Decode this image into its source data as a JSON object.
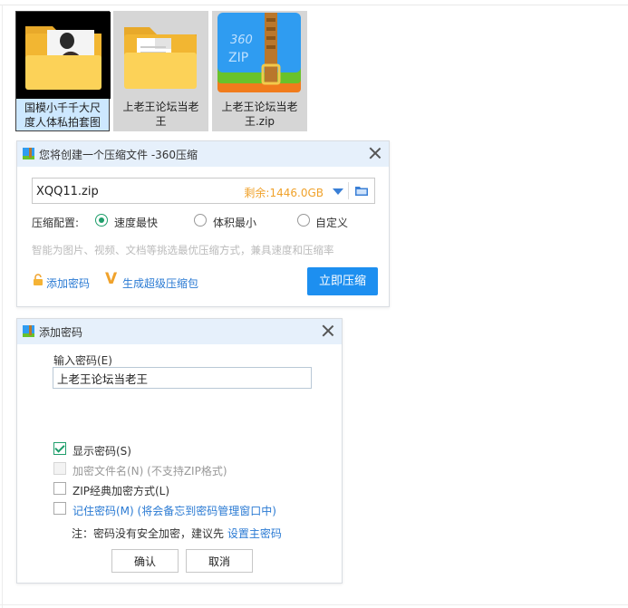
{
  "files": [
    {
      "name_line1": "国模小千千大尺",
      "name_line2": "度人体私拍套图"
    },
    {
      "name_line1": "上老王论坛当老",
      "name_line2": "王"
    },
    {
      "name_line1": "上老王论坛当老",
      "name_line2": "王.zip",
      "badge": "360",
      "badge2": "ZIP"
    }
  ],
  "compress_dialog": {
    "title": "您将创建一个压缩文件 -360压缩",
    "filename": "XQQ11.zip",
    "free_space": "剩余:1446.0GB",
    "config_label": "压缩配置:",
    "options": [
      {
        "label": "速度最快",
        "selected": true
      },
      {
        "label": "体积最小",
        "selected": false
      },
      {
        "label": "自定义",
        "selected": false
      }
    ],
    "description": "智能为图片、视频、文档等挑选最优压缩方式，兼具速度和压缩率",
    "add_password": "添加密码",
    "super_mark": "V",
    "super_package": "生成超级压缩包",
    "compress_now": "立即压缩"
  },
  "password_dialog": {
    "title": "添加密码",
    "input_label": "输入密码(E)",
    "password_value": "上老王论坛当老王",
    "checkboxes": [
      {
        "label": "显示密码(S)",
        "checked": true,
        "disabled": false
      },
      {
        "label": "加密文件名(N) (不支持ZIP格式)",
        "checked": false,
        "disabled": true
      },
      {
        "label": "ZIP经典加密方式(L)",
        "checked": false,
        "disabled": false
      },
      {
        "label": "记住密码(M) (将会备忘到密码管理窗口中)",
        "checked": false,
        "disabled": false
      }
    ],
    "note_prefix": "注：密码没有安全加密，建议先 ",
    "note_link": "设置主密码",
    "ok": "确认",
    "cancel": "取消"
  },
  "colors": {
    "accent": "#1d8ff0",
    "radio_green": "#1f9e6b",
    "link": "#2a7ad3",
    "free_space": "#f0a22b"
  }
}
